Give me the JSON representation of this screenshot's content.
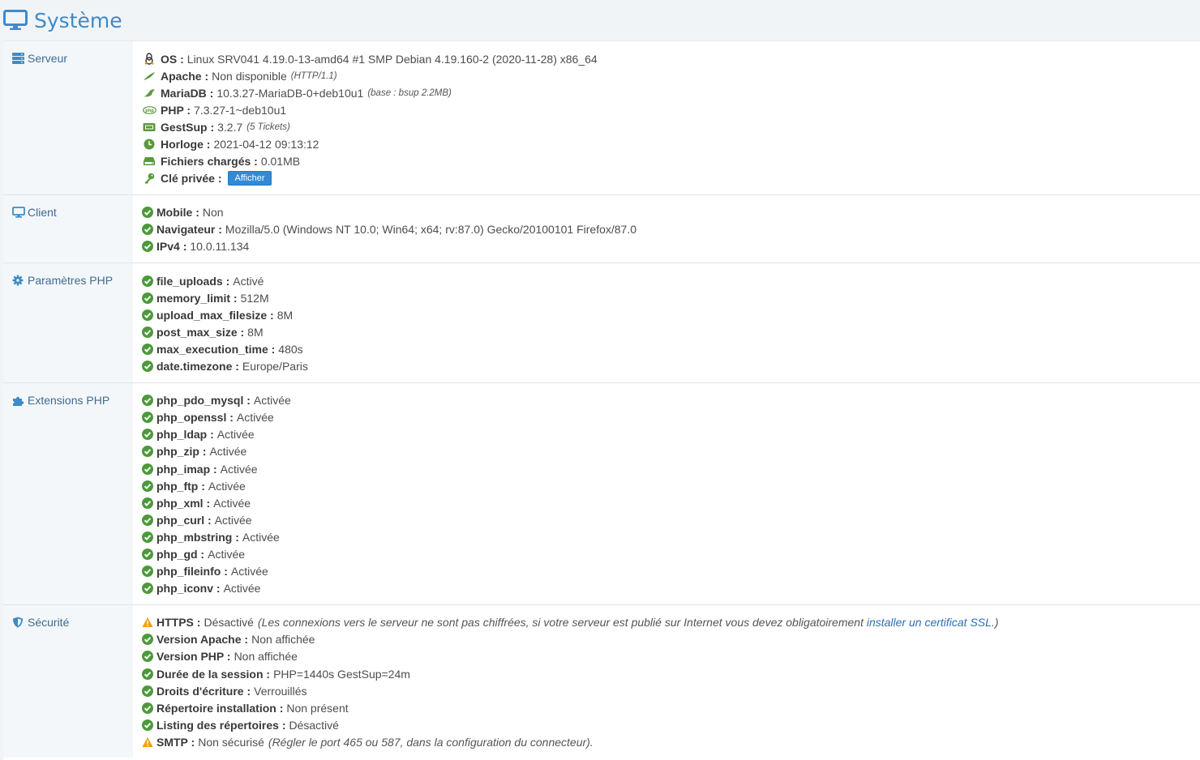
{
  "page": {
    "title": "Système"
  },
  "colors": {
    "accent": "#3d8bc9",
    "ok": "#4c9a3a",
    "warn": "#f0a30a",
    "button": "#3389d3"
  },
  "sections": {
    "serveur": {
      "label": "Serveur",
      "rows": [
        {
          "icon": "linux-icon",
          "key": "OS :",
          "val": "Linux SRV041 4.19.0-13-amd64 #1 SMP Debian 4.19.160-2 (2020-11-28) x86_64"
        },
        {
          "icon": "apache-feather-icon",
          "key": "Apache :",
          "val": "Non disponible",
          "note": "(HTTP/1.1)"
        },
        {
          "icon": "mariadb-seal-icon",
          "key": "MariaDB :",
          "val": "10.3.27-MariaDB-0+deb10u1",
          "note": "(base : bsup 2.2MB)"
        },
        {
          "icon": "php-logo-icon",
          "key": "PHP :",
          "val": "7.3.27-1~deb10u1"
        },
        {
          "icon": "ticket-icon",
          "key": "GestSup :",
          "val": "3.2.7",
          "note": "(5 Tickets)"
        },
        {
          "icon": "clock-icon",
          "key": "Horloge :",
          "val": "2021-04-12 09:13:12"
        },
        {
          "icon": "hdd-icon",
          "key": "Fichiers chargés :",
          "val": "0.01MB"
        },
        {
          "icon": "key-icon",
          "key": "Clé privée :",
          "button": "Afficher"
        }
      ]
    },
    "client": {
      "label": "Client",
      "rows": [
        {
          "key": "Mobile :",
          "val": "Non"
        },
        {
          "key": "Navigateur :",
          "val": "Mozilla/5.0 (Windows NT 10.0; Win64; x64; rv:87.0) Gecko/20100101 Firefox/87.0"
        },
        {
          "key": "IPv4 :",
          "val": "10.0.11.134"
        }
      ]
    },
    "php_params": {
      "label": "Paramètres PHP",
      "rows": [
        {
          "key": "file_uploads :",
          "val": "Activé"
        },
        {
          "key": "memory_limit :",
          "val": "512M"
        },
        {
          "key": "upload_max_filesize :",
          "val": "8M"
        },
        {
          "key": "post_max_size :",
          "val": "8M"
        },
        {
          "key": "max_execution_time :",
          "val": "480s"
        },
        {
          "key": "date.timezone :",
          "val": "Europe/Paris"
        }
      ]
    },
    "php_ext": {
      "label": "Extensions PHP",
      "rows": [
        {
          "key": "php_pdo_mysql :",
          "val": "Activée"
        },
        {
          "key": "php_openssl :",
          "val": "Activée"
        },
        {
          "key": "php_ldap :",
          "val": "Activée"
        },
        {
          "key": "php_zip :",
          "val": "Activée"
        },
        {
          "key": "php_imap :",
          "val": "Activée"
        },
        {
          "key": "php_ftp :",
          "val": "Activée"
        },
        {
          "key": "php_xml :",
          "val": "Activée"
        },
        {
          "key": "php_curl :",
          "val": "Activée"
        },
        {
          "key": "php_mbstring :",
          "val": "Activée"
        },
        {
          "key": "php_gd :",
          "val": "Activée"
        },
        {
          "key": "php_fileinfo :",
          "val": "Activée"
        },
        {
          "key": "php_iconv :",
          "val": "Activée"
        }
      ]
    },
    "securite": {
      "label": "Sécurité",
      "rows": [
        {
          "status": "warn",
          "key": "HTTPS :",
          "val": "Désactivé",
          "note_pre": "(Les connexions vers le serveur ne sont pas chiffrées, si votre serveur est publié sur Internet vous devez obligatoirement ",
          "link": "installer un certificat SSL",
          "note_post": ".)"
        },
        {
          "status": "ok",
          "key": "Version Apache :",
          "val": "Non affichée"
        },
        {
          "status": "ok",
          "key": "Version PHP :",
          "val": "Non affichée"
        },
        {
          "status": "ok",
          "key": "Durée de la session :",
          "val": "PHP=1440s GestSup=24m"
        },
        {
          "status": "ok",
          "key": "Droits d'écriture :",
          "val": "Verrouillés"
        },
        {
          "status": "ok",
          "key": "Répertoire installation :",
          "val": "Non présent"
        },
        {
          "status": "ok",
          "key": "Listing des répertoires :",
          "val": "Désactivé"
        },
        {
          "status": "warn",
          "key": "SMTP :",
          "val": "Non sécurisé",
          "note": "(Régler le port 465 ou 587, dans la configuration du connecteur)."
        }
      ]
    }
  }
}
